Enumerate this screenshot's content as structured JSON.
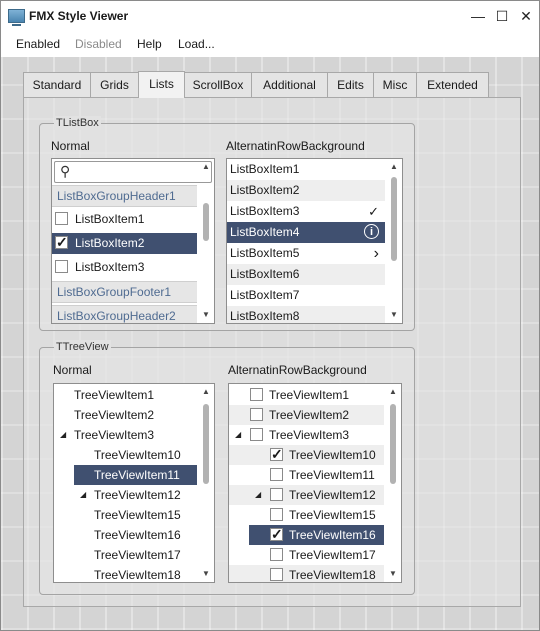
{
  "window": {
    "title": "FMX Style Viewer",
    "minimize_glyph": "—",
    "maximize_glyph": "☐",
    "close_glyph": "✕"
  },
  "menu": [
    "Enabled",
    "Disabled",
    "Help",
    "Load..."
  ],
  "tabs": [
    "Standard",
    "Grids",
    "Lists",
    "ScrollBox",
    "Additional",
    "Edits",
    "Misc",
    "Extended"
  ],
  "active_tab": "Lists",
  "listbox_group": {
    "title": "TListBox",
    "normal": {
      "caption": "Normal",
      "search_placeholder": "",
      "items": [
        {
          "label": "ListBoxGroupHeader1",
          "kind": "header"
        },
        {
          "label": "ListBoxItem1",
          "checked": false
        },
        {
          "label": "ListBoxItem2",
          "checked": true,
          "selected": true
        },
        {
          "label": "ListBoxItem3",
          "checked": false
        },
        {
          "label": "ListBoxGroupFooter1",
          "kind": "header"
        },
        {
          "label": "ListBoxGroupHeader2",
          "kind": "header"
        }
      ]
    },
    "alternating": {
      "caption": "AlternatinRowBackground",
      "items": [
        {
          "label": "ListBoxItem1"
        },
        {
          "label": "ListBoxItem2"
        },
        {
          "label": "ListBoxItem3",
          "accessory": "checkmark"
        },
        {
          "label": "ListBoxItem4",
          "accessory": "info",
          "selected": true
        },
        {
          "label": "ListBoxItem5",
          "accessory": "chevron"
        },
        {
          "label": "ListBoxItem6"
        },
        {
          "label": "ListBoxItem7"
        },
        {
          "label": "ListBoxItem8"
        }
      ]
    }
  },
  "treeview_group": {
    "title": "TTreeView",
    "normal": {
      "caption": "Normal",
      "items": [
        {
          "label": "TreeViewItem1",
          "level": 0
        },
        {
          "label": "TreeViewItem2",
          "level": 0
        },
        {
          "label": "TreeViewItem3",
          "level": 0,
          "expanded": true
        },
        {
          "label": "TreeViewItem10",
          "level": 1
        },
        {
          "label": "TreeViewItem11",
          "level": 1,
          "selected": true
        },
        {
          "label": "TreeViewItem12",
          "level": 1,
          "expanded": true
        },
        {
          "label": "TreeViewItem15",
          "level": 1
        },
        {
          "label": "TreeViewItem16",
          "level": 1
        },
        {
          "label": "TreeViewItem17",
          "level": 1
        },
        {
          "label": "TreeViewItem18",
          "level": 1
        }
      ]
    },
    "alternating": {
      "caption": "AlternatinRowBackground",
      "items": [
        {
          "label": "TreeViewItem1",
          "level": 0,
          "checked": false
        },
        {
          "label": "TreeViewItem2",
          "level": 0,
          "checked": false
        },
        {
          "label": "TreeViewItem3",
          "level": 0,
          "checked": false,
          "expanded": true
        },
        {
          "label": "TreeViewItem10",
          "level": 1,
          "checked": true
        },
        {
          "label": "TreeViewItem11",
          "level": 1,
          "checked": false
        },
        {
          "label": "TreeViewItem12",
          "level": 1,
          "checked": false,
          "expanded": true
        },
        {
          "label": "TreeViewItem15",
          "level": 1,
          "checked": false
        },
        {
          "label": "TreeViewItem16",
          "level": 1,
          "checked": true,
          "selected": true
        },
        {
          "label": "TreeViewItem17",
          "level": 1,
          "checked": false
        },
        {
          "label": "TreeViewItem18",
          "level": 1,
          "checked": false
        }
      ]
    }
  },
  "glyphs": {
    "check": "✓",
    "info": "i",
    "chevron": "›",
    "expander": "◢",
    "scroll_up": "▲",
    "scroll_down": "▼",
    "search": "⚲"
  },
  "colors": {
    "selection": "#405070",
    "header_text": "#4f6b91"
  }
}
